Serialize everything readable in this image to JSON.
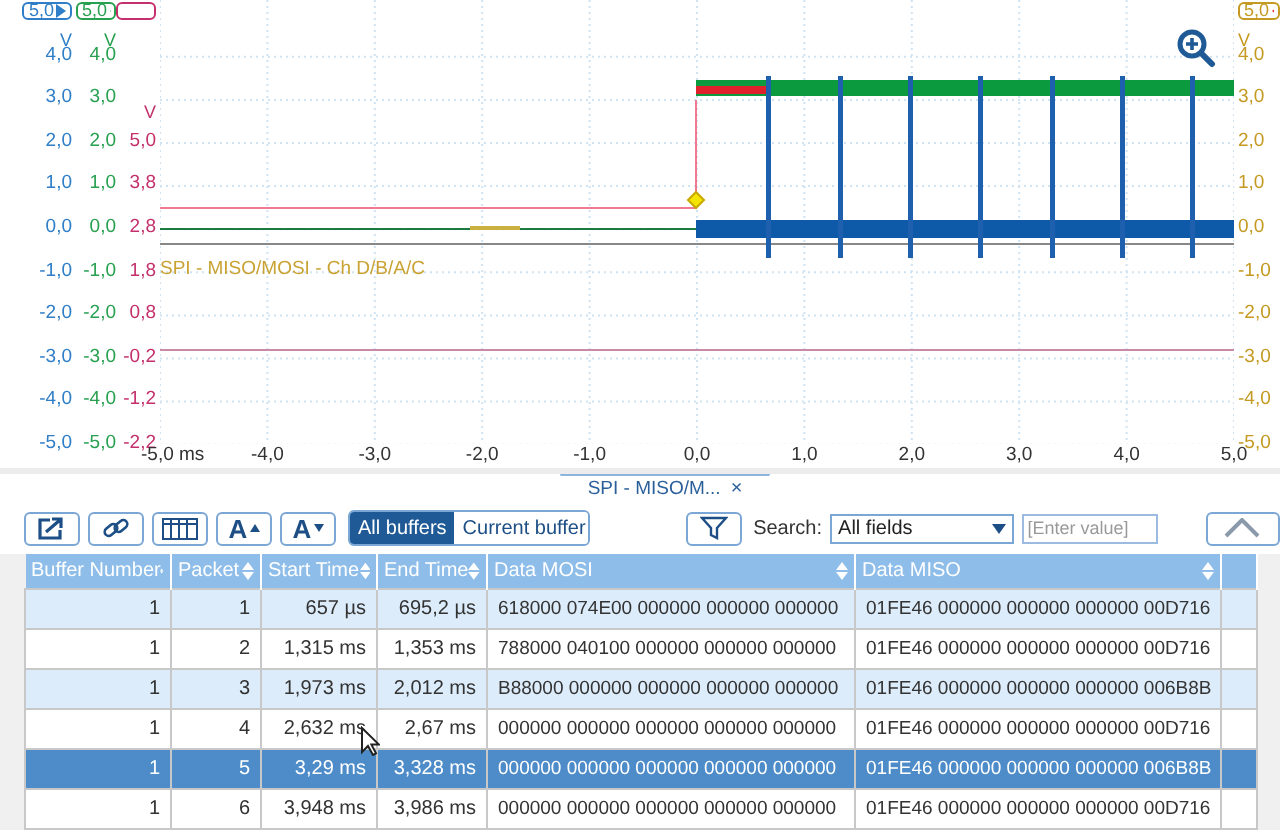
{
  "axes_left": [
    {
      "color": "#2f7ec7",
      "range": "5,0",
      "unit": "V",
      "ticks": [
        "4,0",
        "3,0",
        "2,0",
        "1,0",
        "0,0",
        "-1,0",
        "-2,0",
        "-3,0",
        "-4,0",
        "-5,0"
      ]
    },
    {
      "color": "#27a050",
      "range": "5,0",
      "unit": "V",
      "ticks": [
        "4,0",
        "3,0",
        "2,0",
        "1,0",
        "0,0",
        "-1,0",
        "-2,0",
        "-3,0",
        "-4,0",
        "-5,0"
      ]
    },
    {
      "color": "#c4306b",
      "unit": "V",
      "ticks": [
        "5,0",
        "3,8",
        "2,8",
        "1,8",
        "0,8",
        "-0,2",
        "-1,2",
        "-2,2"
      ]
    }
  ],
  "axis_right": {
    "color": "#c49a22",
    "range": "5,0",
    "unit": "V",
    "ticks": [
      "4,0",
      "3,0",
      "2,0",
      "1,0",
      "0,0",
      "-1,0",
      "-2,0",
      "-3,0",
      "-4,0",
      "-5,0"
    ]
  },
  "x_ticks": [
    "-5,0",
    "-4,0",
    "-3,0",
    "-2,0",
    "-1,0",
    "0,0",
    "1,0",
    "2,0",
    "3,0",
    "4,0",
    "5,0"
  ],
  "x_unit": "ms",
  "trace_label": "SPI - MISO/MOSI - Ch D/B/A/C",
  "tab": {
    "label": "SPI - MISO/M...",
    "close": "×"
  },
  "toolbar": {
    "font_buttons": [
      {
        "label": "A",
        "kind": "increase"
      },
      {
        "label": "A",
        "kind": "decrease"
      }
    ],
    "buffer_modes": [
      {
        "label": "All buffers",
        "selected": true
      },
      {
        "label": "Current buffer",
        "selected": false
      }
    ],
    "search_label": "Search:",
    "search_field": "All fields",
    "value_placeholder": "[Enter value]"
  },
  "table": {
    "columns": [
      "Buffer Number",
      "Packet",
      "Start Time",
      "End Time",
      "Data MOSI",
      "Data MISO"
    ],
    "rows": [
      {
        "cells": [
          "1",
          "1",
          "657 µs",
          "695,2 µs",
          "618000 074E00 000000 000000 000000",
          "01FE46 000000 000000 000000 00D716"
        ],
        "selected": false
      },
      {
        "cells": [
          "1",
          "2",
          "1,315 ms",
          "1,353 ms",
          "788000 040100 000000 000000 000000",
          "01FE46 000000 000000 000000 00D716"
        ],
        "selected": false
      },
      {
        "cells": [
          "1",
          "3",
          "1,973 ms",
          "2,012 ms",
          "B88000 000000 000000 000000 000000",
          "01FE46 000000 000000 000000 006B8B"
        ],
        "selected": false
      },
      {
        "cells": [
          "1",
          "4",
          "2,632 ms",
          "2,67 ms",
          "000000 000000 000000 000000 000000",
          "01FE46 000000 000000 000000 00D716"
        ],
        "selected": false
      },
      {
        "cells": [
          "1",
          "5",
          "3,29 ms",
          "3,328 ms",
          "000000 000000 000000 000000 000000",
          "01FE46 000000 000000 000000 006B8B"
        ],
        "selected": true
      },
      {
        "cells": [
          "1",
          "6",
          "3,948 ms",
          "3,986 ms",
          "000000 000000 000000 000000 000000",
          "01FE46 000000 000000 000000 00D716"
        ],
        "selected": false
      }
    ]
  }
}
